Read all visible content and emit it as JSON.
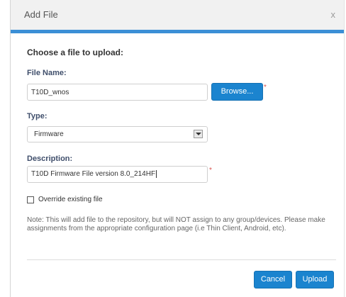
{
  "dialog": {
    "title": "Add File",
    "close_label": "x",
    "heading": "Choose a file to upload:"
  },
  "file_name": {
    "label": "File Name:",
    "value": "T10D_wnos",
    "browse_label": "Browse...",
    "required_mark": "*"
  },
  "type": {
    "label": "Type:",
    "selected": "Firmware"
  },
  "description": {
    "label": "Description:",
    "value": "T10D Firmware File version 8.0_214HF",
    "required_mark": "*"
  },
  "override": {
    "label": "Override existing file",
    "checked": false
  },
  "note": "Note: This will add file to the repository, but will NOT assign to any group/devices. Please make assignments from the appropriate configuration page (i.e Thin Client, Android, etc).",
  "footer": {
    "cancel_label": "Cancel",
    "upload_label": "Upload"
  },
  "colors": {
    "accent": "#3b8fd6",
    "button": "#1b84cf",
    "required": "#d9534f"
  }
}
